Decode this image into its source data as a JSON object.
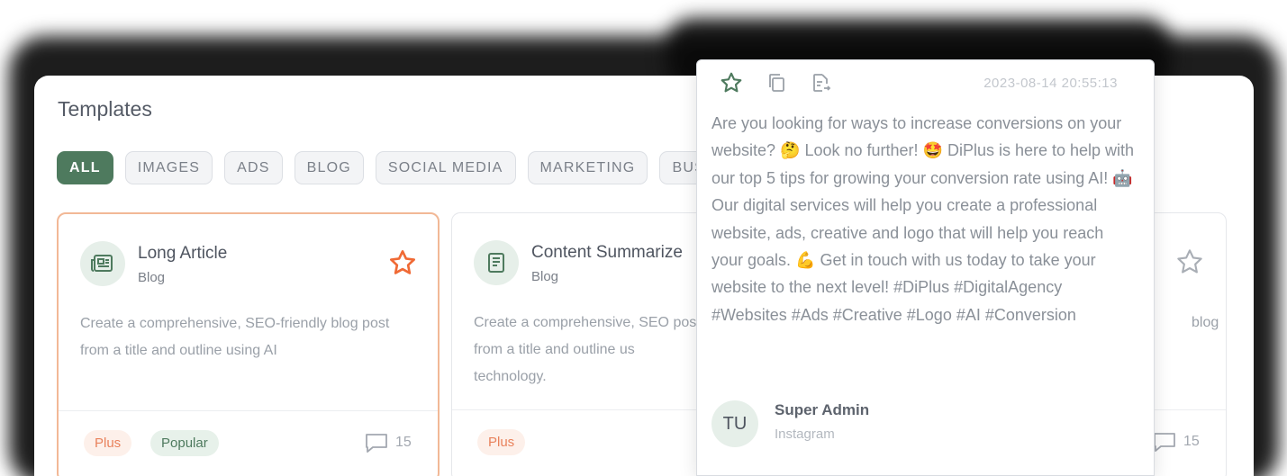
{
  "panel": {
    "title": "Templates"
  },
  "filters": [
    {
      "label": "ALL",
      "active": true
    },
    {
      "label": "IMAGES"
    },
    {
      "label": "ADS"
    },
    {
      "label": "BLOG"
    },
    {
      "label": "SOCIAL MEDIA"
    },
    {
      "label": "MARKETING"
    },
    {
      "label": "BUS"
    }
  ],
  "cards": [
    {
      "title": "Long Article",
      "category": "Blog",
      "icon": "newspaper-icon",
      "description": "Create a comprehensive, SEO-friendly blog post from a title and outline using AI",
      "badges": [
        "Plus",
        "Popular"
      ],
      "comments": "15",
      "starred": true
    },
    {
      "title": "Content Summarize",
      "category": "Blog",
      "icon": "document-icon",
      "description": "Create a comprehensive, SEO post from a title and outline us technology.",
      "badges": [
        "Plus"
      ]
    },
    {
      "description": "blog",
      "comments": "15",
      "starred": false
    }
  ],
  "popup": {
    "date": "2023-08-14 20:55:13",
    "text": "Are you looking for ways to increase conversions on your website? 🤔 Look no further! 🤩 DiPlus is here to help with our top 5 tips for growing your conversion rate using AI! 🤖 Our digital services will help you create a professional website, ads, creative and logo that will help you reach your goals. 💪 Get in touch with us today to take your website to the next level! #DiPlus #DigitalAgency #Websites #Ads #Creative #Logo #AI #Conversion",
    "avatar_initials": "TU",
    "author": "Super Admin",
    "source": "Instagram"
  },
  "colors": {
    "accent": "#4e7a5e",
    "highlight": "#f06a35",
    "plus": "#e9825c"
  }
}
